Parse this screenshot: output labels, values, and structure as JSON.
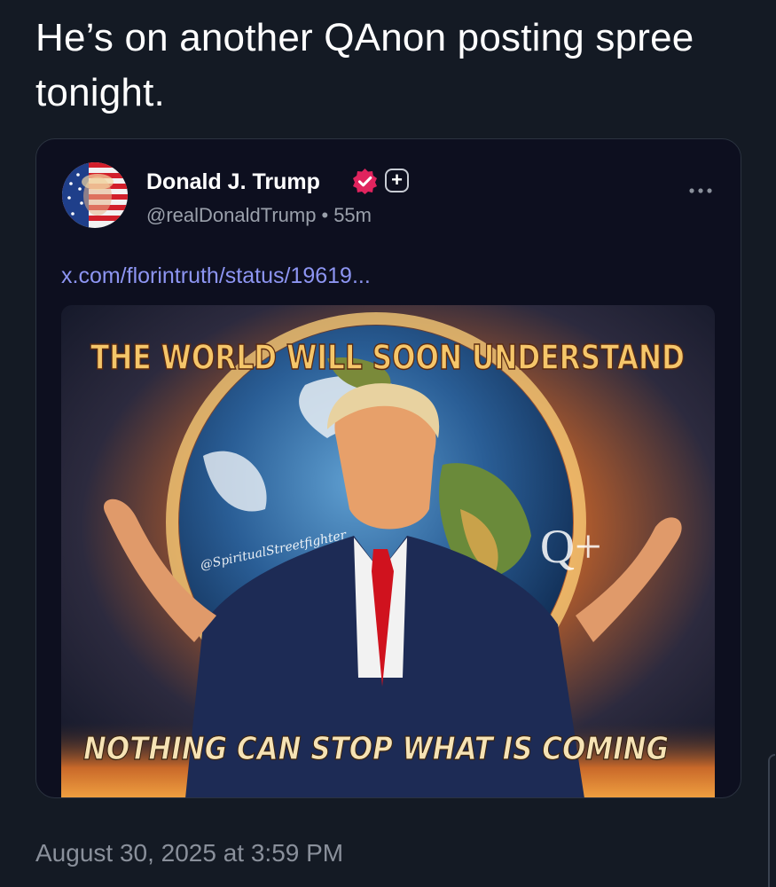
{
  "post": {
    "text": "He’s on another QAnon posting spree tonight.",
    "timestamp": "August 30, 2025 at 3:59 PM"
  },
  "quoted_post": {
    "author_name": "Donald J. Trump",
    "handle": "@realDonaldTrump",
    "separator": "•",
    "age": "55m",
    "plus_badge": "+",
    "link": "x.com/florintruth/status/19619...",
    "image": {
      "top_caption": "THE WORLD WILL SOON UNDERSTAND",
      "bottom_caption": "NOTHING CAN STOP WHAT IS COMING",
      "watermark": "@SpiritualStreetfighter",
      "q_symbol": "Q+"
    }
  },
  "icons": {
    "verified": "verified-badge-icon",
    "more": "more-options-icon",
    "plus": "plus-badge-icon"
  },
  "colors": {
    "background": "#141a24",
    "card": "#0d0f1f",
    "link": "#8d95f2",
    "verified": "#e0245e",
    "muted": "#9aa0ab"
  }
}
